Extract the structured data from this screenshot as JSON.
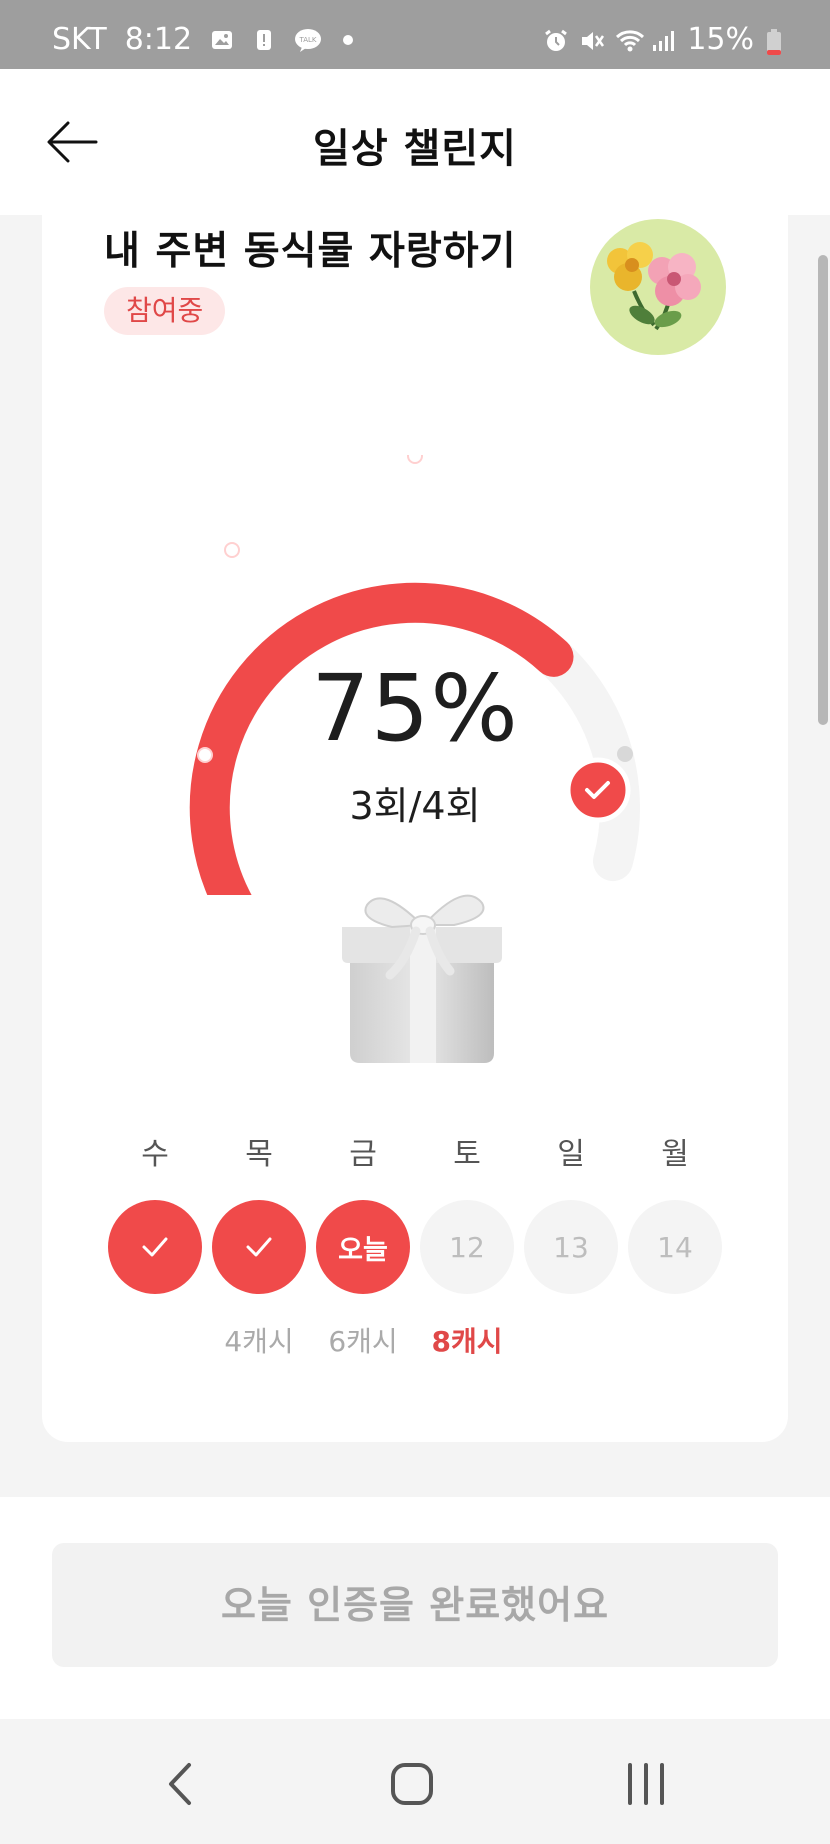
{
  "status_bar": {
    "carrier": "SKT",
    "time": "8:12",
    "battery": "15%",
    "icons": [
      "gallery-icon",
      "alert-icon",
      "kakaotalk-icon",
      "dot-icon",
      "alarm-icon",
      "mute-icon",
      "wifi-icon",
      "signal-icon",
      "battery-icon"
    ]
  },
  "header": {
    "title": "일상 챌린지",
    "back_icon": "arrow-left-icon"
  },
  "challenge": {
    "title": "내 주변 동식물 자랑하기",
    "status": "참여중",
    "image_icon": "flower-icon"
  },
  "progress": {
    "percent_text": "75%",
    "count_text": "3회/4회",
    "fraction": 0.75,
    "accent_color": "#f04a4a",
    "track_color": "#f4f4f4"
  },
  "reward_image": "gift-box-icon",
  "week": [
    {
      "label": "수",
      "state": "done",
      "reward": ""
    },
    {
      "label": "목",
      "state": "done",
      "reward": "4캐시"
    },
    {
      "label": "금",
      "state": "today",
      "text": "오늘",
      "reward": "6캐시"
    },
    {
      "label": "토",
      "state": "future",
      "text": "12",
      "reward": "8캐시",
      "reward_highlight": true
    },
    {
      "label": "일",
      "state": "future",
      "text": "13",
      "reward": ""
    },
    {
      "label": "월",
      "state": "future",
      "text": "14",
      "reward": ""
    }
  ],
  "bottom_button": {
    "label": "오늘 인증을 완료했어요"
  },
  "nav": {
    "back": "nav-back-icon",
    "home": "nav-home-icon",
    "recents": "nav-recents-icon"
  }
}
